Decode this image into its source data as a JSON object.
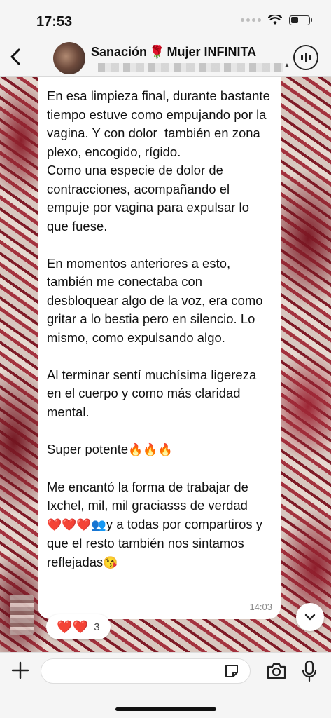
{
  "status_bar": {
    "time": "17:53"
  },
  "header": {
    "title_left": "Sanación",
    "title_emoji": "🌹",
    "title_right": "Mujer INFINITA",
    "icons": [
      "back-arrow-icon",
      "voice-chat-icon"
    ]
  },
  "message": {
    "paragraphs": [
      "En esa limpieza final, durante bastante tiempo estuve como empujando por la vagina. Y con dolor  también en zona plexo, encogido, rígido.\nComo una especie de dolor de contracciones, acompañando el empuje por vagina para expulsar lo que fuese.",
      "En momentos anteriores a esto, también me conectaba con desbloquear algo de la voz, era como gritar a lo bestia pero en silencio. Lo mismo, como expulsando algo.",
      "Al terminar sentí muchísima ligereza en el cuerpo y como más claridad mental.",
      "Super potente"
    ],
    "fire_emojis": "🔥🔥🔥",
    "last_paragraph_start": "Me encantó la forma de trabajar de Ixchel, mil, mil graciasss de verdad",
    "last_emojis_hearts": "❤️❤️❤️",
    "last_emoji_people": "👥",
    "last_paragraph_end": "y a todas por compartiros y que el resto también nos sintamos reflejadas",
    "last_emoji_kiss": "😘",
    "time": "14:03"
  },
  "reactions": {
    "emojis": "❤️❤️",
    "count": "3"
  },
  "composer": {
    "placeholder": ""
  },
  "colors": {
    "accent": "#e11a2b",
    "bubble": "#ffffff",
    "bar": "#f5f5f5"
  }
}
